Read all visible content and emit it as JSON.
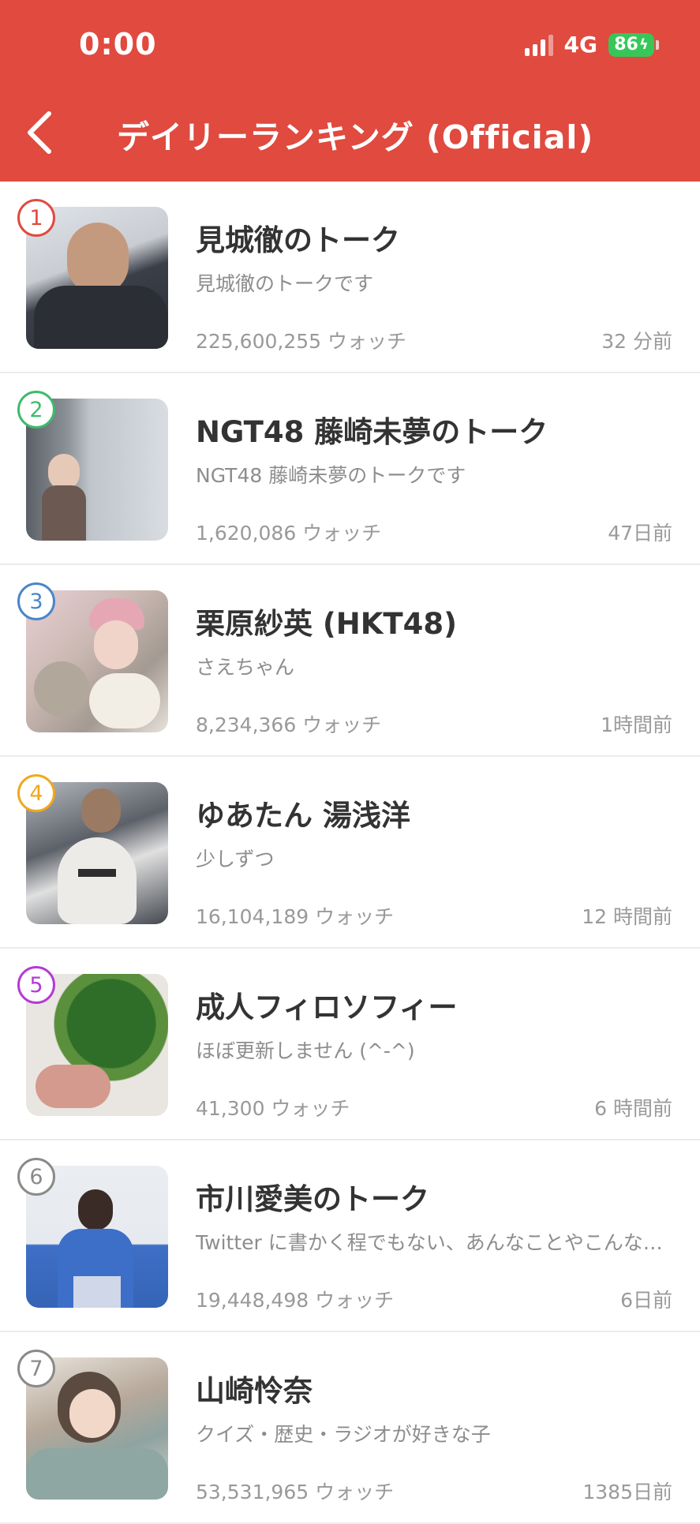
{
  "status_bar": {
    "time": "0:00",
    "network": "4G",
    "battery": "86"
  },
  "header": {
    "title": "デイリーランキング (Official)"
  },
  "colors": {
    "header_bg": "#e04a3f",
    "rank1": "#e04a3f",
    "rank2": "#3dbb6b",
    "rank3": "#4a86c8",
    "rank4": "#f0a81b",
    "rank5": "#b53ad6",
    "rank_other": "#8a8a8a"
  },
  "rankings": [
    {
      "rank": "1",
      "name": "見城徹のトーク",
      "description": "見城徹のトークです",
      "watchers": "225,600,255 ウォッチ",
      "updated": "32 分前"
    },
    {
      "rank": "2",
      "name": "NGT48 藤崎未夢のトーク",
      "description": "NGT48 藤崎未夢のトークです",
      "watchers": "1,620,086 ウォッチ",
      "updated": "47日前"
    },
    {
      "rank": "3",
      "name": "栗原紗英 (HKT48)",
      "description": "さえちゃん",
      "watchers": "8,234,366 ウォッチ",
      "updated": "1時間前"
    },
    {
      "rank": "4",
      "name": "ゆあたん 湯浅洋",
      "description": "少しずつ",
      "watchers": "16,104,189 ウォッチ",
      "updated": "12 時間前"
    },
    {
      "rank": "5",
      "name": "成人フィロソフィー",
      "description": "ほぼ更新しません (^-^)",
      "watchers": "41,300 ウォッチ",
      "updated": "6 時間前"
    },
    {
      "rank": "6",
      "name": "市川愛美のトーク",
      "description": "Twitter に書かく程でもない、あんなことやこんな…",
      "watchers": "19,448,498 ウォッチ",
      "updated": "6日前"
    },
    {
      "rank": "7",
      "name": "山崎怜奈",
      "description": "クイズ・歴史・ラジオが好きな子",
      "watchers": "53,531,965 ウォッチ",
      "updated": "1385日前"
    }
  ]
}
